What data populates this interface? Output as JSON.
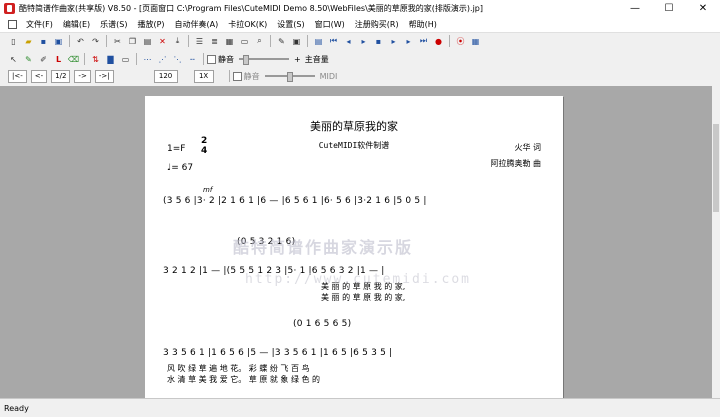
{
  "window": {
    "title": "酷特简谱作曲家(共享版) V8.50 - [页面窗口  C:\\Program Files\\CuteMIDI Demo 8.50\\WebFiles\\美丽的草原我的家(排版演示).jp]",
    "minimize": "—",
    "maximize": "☐",
    "close": "✕"
  },
  "menu": [
    "文件(F)",
    "编辑(E)",
    "乐谱(S)",
    "播放(P)",
    "自动伴奏(A)",
    "卡拉OK(K)",
    "设置(S)",
    "窗口(W)",
    "注册购买(R)",
    "帮助(H)"
  ],
  "toolbar3": {
    "nav_first": "|<-",
    "nav_prev": "<-",
    "page": "1/2",
    "nav_next": "->",
    "nav_last": "->|",
    "tempo": "120",
    "speed": "1X"
  },
  "mixer": {
    "mute1": "静音",
    "mute2": "静音",
    "master_volume": "主音量",
    "plus": "+",
    "plus2": "+",
    "midi": "MIDI"
  },
  "score": {
    "title": "美丽的草原我的家",
    "subtitle": "CuteMIDI软件制谱",
    "lyricist": "火华 词",
    "composer": "阿拉腾奥勒 曲",
    "key": "1=F",
    "time_top": "2",
    "time_bottom": "4",
    "tempo_mark": "♩= 67",
    "dynamic": "mf",
    "line1": "(3 5 6  |3·   2  |2   1 6 1 |6  —   |6  5 6 1 |6·   5 6 |3·2 1 6 |5   0 5 |",
    "line2": "(0 5   3 2 1 6)",
    "line3": "3   2 1 2 |1   —   |(5 5 5 1 2 3 |5·   1  |6 5 6 3 2 |1   —   |",
    "lyric3a": "美 丽 的 草        原          我      的      家,",
    "lyric3b": "美 丽 的 草        原          我      的      家,",
    "line4": "(0 1   6 5 6 5)",
    "line5": "3 3 5 6 1 |1   6 5 6 |5   —   |3 3 5 6 1 |1   6 5 |6   5 3 5 |",
    "lyric5a": "风 吹 绿 草    遍    地        花。     彩 蝶 纷        飞        百    鸟",
    "lyric5b": "水 清 草 美    我    爱        它。     草 原 就        象        绿    色    的",
    "watermark_text": "酷特简谱作曲家演示版",
    "watermark_url": "http://www.cutemidi.com"
  },
  "status": "Ready"
}
